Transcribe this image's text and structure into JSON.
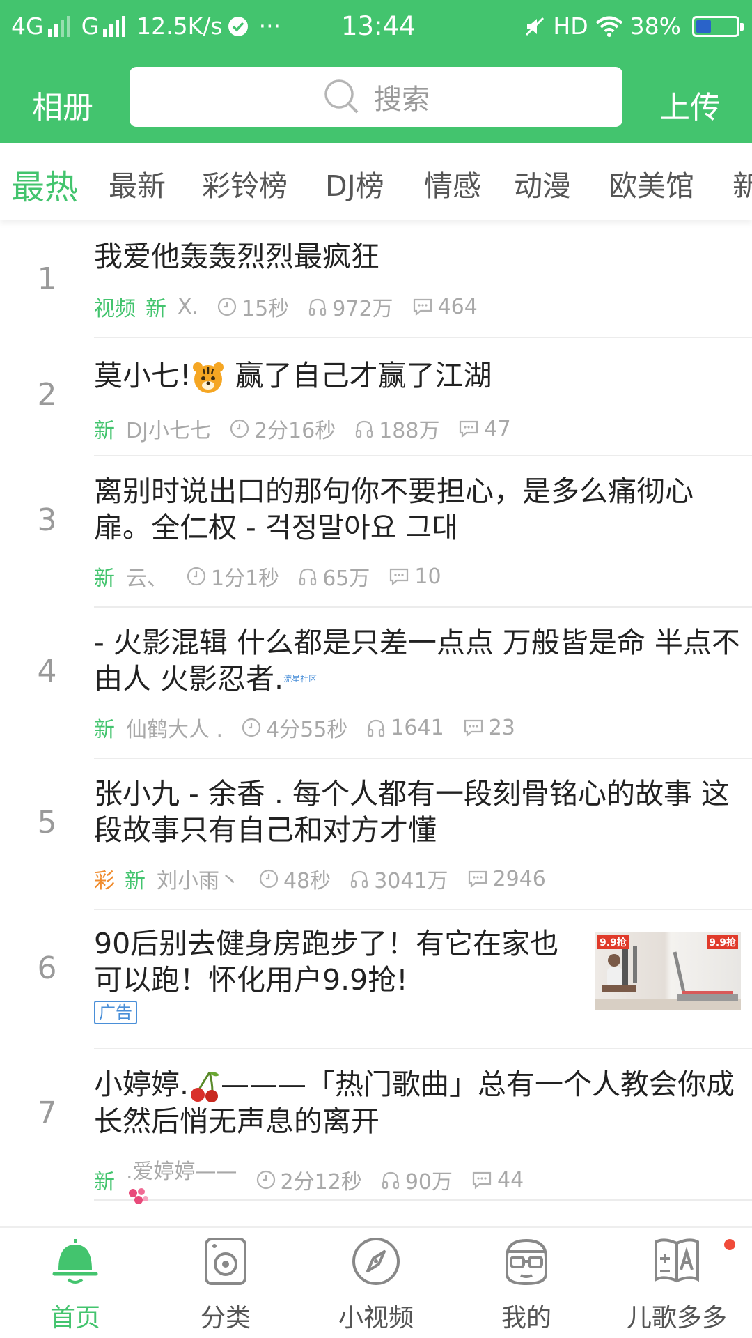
{
  "status_bar": {
    "network_1": "4G",
    "network_2": "G",
    "speed": "12.5K/s",
    "more": "···",
    "time": "13:44",
    "hd": "HD",
    "battery": "38%",
    "battery_level": 0.38,
    "battery_color": "#2a63c9"
  },
  "header": {
    "album_label": "相册",
    "search_placeholder": "搜索",
    "upload_label": "上传",
    "accent_color": "#43c46e"
  },
  "tabs": [
    "最热",
    "最新",
    "彩铃榜",
    "DJ榜",
    "情感",
    "动漫",
    "欧美馆",
    "新"
  ],
  "active_tab": "最热",
  "list": [
    {
      "rank": "1",
      "title": "我爱他轰轰烈烈最疯狂",
      "tag_video": "视频",
      "tag_new": "新",
      "author": "X.",
      "duration": "15秒",
      "plays": "972万",
      "comments": "464"
    },
    {
      "rank": "2",
      "title_a": "莫小七!",
      "title_b": " 赢了自己才赢了江湖",
      "emoji": "tiger-face-icon",
      "tag_new": "新",
      "author": "DJ小七七",
      "duration": "2分16秒",
      "plays": "188万",
      "comments": "47"
    },
    {
      "rank": "3",
      "title": "离别时说出口的那句你不要担心，是多么痛彻心扉。全仁权 - 걱정말아요 그대",
      "tag_new": "新",
      "author": "云、",
      "duration": "1分1秒",
      "plays": "65万",
      "comments": "10"
    },
    {
      "rank": "4",
      "title": "- 火影混辑 什么都是只差一点点 万般皆是命 半点不由人 火影忍者.",
      "watermark": "流星社区",
      "tag_new": "新",
      "author": "仙鹤大人 .",
      "duration": "4分55秒",
      "plays": "1641",
      "comments": "23"
    },
    {
      "rank": "5",
      "title": "张小九 - 余香 . 每个人都有一段刻骨铭心的故事 这段故事只有自己和对方才懂",
      "tag_cai": "彩",
      "tag_new": "新",
      "author": "刘小雨丶",
      "duration": "48秒",
      "plays": "3041万",
      "comments": "2946"
    },
    {
      "rank": "6",
      "title": "90后别去健身房跑步了！有它在家也可以跑！怀化用户9.9抢!",
      "ad_badge": "广告",
      "ad_price_tag": "9.9抢"
    },
    {
      "rank": "7",
      "title_a": "小婷婷.",
      "title_b": "———「热门歌曲」总有一个人教会你成长然后悄无声息的离开",
      "emoji": "cherries-icon",
      "tag_new": "新",
      "author": ".爱婷婷——",
      "author_emoji": "flowers-icon",
      "duration": "2分12秒",
      "plays": "90万",
      "comments": "44"
    }
  ],
  "bottom_nav": [
    {
      "label": "首页",
      "icon": "bell-icon",
      "active": true
    },
    {
      "label": "分类",
      "icon": "speaker-icon",
      "active": false
    },
    {
      "label": "小视频",
      "icon": "compass-icon",
      "active": false
    },
    {
      "label": "我的",
      "icon": "glasses-face-icon",
      "active": false
    },
    {
      "label": "儿歌多多",
      "icon": "abc-board-icon",
      "active": false,
      "badge": true
    }
  ],
  "colors": {
    "accent": "#43c46e",
    "tag_cai": "#f08c2e",
    "ad_badge": "#4a8fd8",
    "notification_dot": "#f04b3a"
  }
}
